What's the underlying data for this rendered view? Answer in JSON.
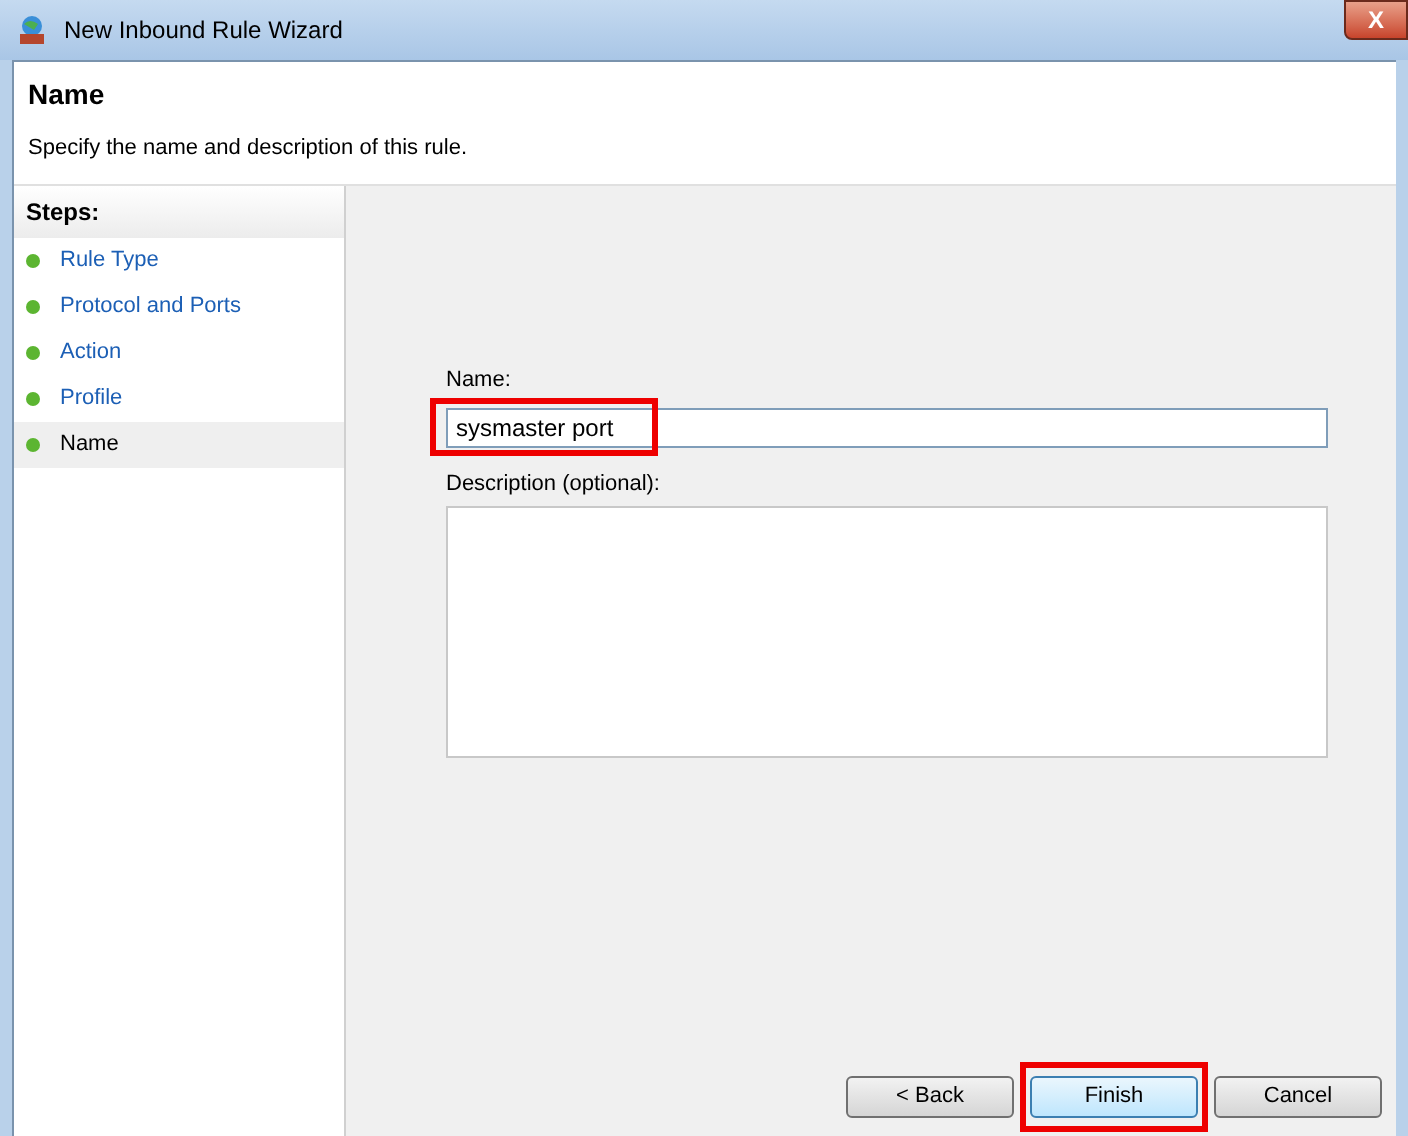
{
  "window": {
    "title": "New Inbound Rule Wizard",
    "close_label": "X"
  },
  "header": {
    "title": "Name",
    "subtitle": "Specify the name and description of this rule."
  },
  "steps": {
    "heading": "Steps:",
    "items": [
      {
        "label": "Rule Type",
        "selected": false
      },
      {
        "label": "Protocol and Ports",
        "selected": false
      },
      {
        "label": "Action",
        "selected": false
      },
      {
        "label": "Profile",
        "selected": false
      },
      {
        "label": "Name",
        "selected": true
      }
    ]
  },
  "form": {
    "name_label": "Name:",
    "name_value": "sysmaster port",
    "name_highlighted": true,
    "description_label": "Description (optional):"
  },
  "buttons": [
    {
      "label": "< Back",
      "highlighted": false,
      "default": false
    },
    {
      "label": "Finish",
      "highlighted": true,
      "default": true
    },
    {
      "label": "Cancel",
      "highlighted": false,
      "default": false
    }
  ]
}
